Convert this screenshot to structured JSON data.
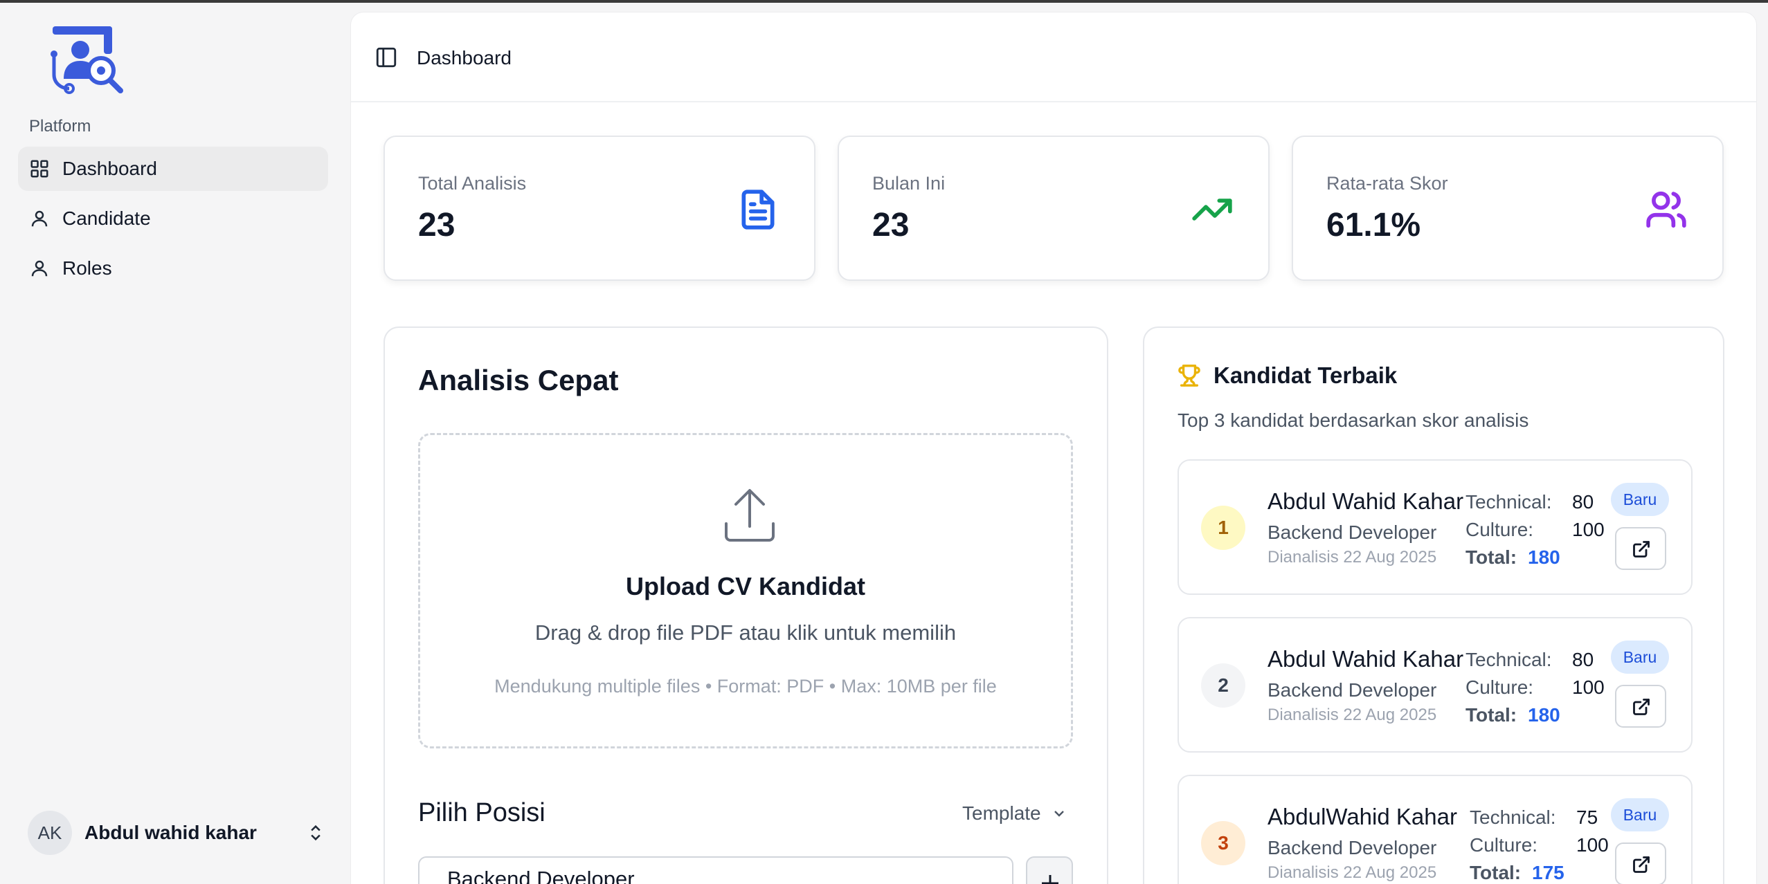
{
  "sidebar": {
    "section_label": "Platform",
    "items": [
      {
        "label": "Dashboard",
        "icon": "grid-icon",
        "active": true
      },
      {
        "label": "Candidate",
        "icon": "user-icon",
        "active": false
      },
      {
        "label": "Roles",
        "icon": "user-icon",
        "active": false
      }
    ],
    "user": {
      "initials": "AK",
      "name": "Abdul wahid kahar"
    }
  },
  "header": {
    "title": "Dashboard"
  },
  "stats": [
    {
      "label": "Total Analisis",
      "value": "23",
      "icon": "document-icon",
      "color": "#2563eb"
    },
    {
      "label": "Bulan Ini",
      "value": "23",
      "icon": "trending-up-icon",
      "color": "#16a34a"
    },
    {
      "label": "Rata-rata Skor",
      "value": "61.1%",
      "icon": "users-icon",
      "color": "#9333ea"
    }
  ],
  "quick": {
    "title": "Analisis Cepat",
    "upload_title": "Upload CV Kandidat",
    "upload_sub": "Drag & drop file PDF atau klik untuk memilih",
    "upload_hint": "Mendukung multiple files • Format: PDF • Max: 10MB per file",
    "position_title": "Pilih Posisi",
    "template_label": "Template",
    "selected_position": "Backend Developer"
  },
  "top": {
    "title": "Kandidat Terbaik",
    "subtitle": "Top 3 kandidat berdasarkan skor analisis",
    "candidates": [
      {
        "rank": "1",
        "name": "Abdul Wahid Kahar",
        "role": "Backend Developer",
        "date": "Dianalisis 22 Aug 2025",
        "technical_label": "Technical:",
        "technical": "80",
        "culture_label": "Culture:",
        "culture": "100",
        "total_label": "Total:",
        "total": "180",
        "badge": "Baru"
      },
      {
        "rank": "2",
        "name": "Abdul Wahid Kahar",
        "role": "Backend Developer",
        "date": "Dianalisis 22 Aug 2025",
        "technical_label": "Technical:",
        "technical": "80",
        "culture_label": "Culture:",
        "culture": "100",
        "total_label": "Total:",
        "total": "180",
        "badge": "Baru"
      },
      {
        "rank": "3",
        "name": "AbdulWahid Kahar",
        "role": "Backend Developer",
        "date": "Dianalisis 22 Aug 2025",
        "technical_label": "Technical:",
        "technical": "75",
        "culture_label": "Culture:",
        "culture": "100",
        "total_label": "Total:",
        "total": "175",
        "badge": "Baru"
      }
    ]
  },
  "colors": {
    "accent": "#2563eb",
    "rank1_bg": "#fef9c3",
    "rank2_bg": "#f3f4f6",
    "rank3_bg": "#ffedd5"
  }
}
